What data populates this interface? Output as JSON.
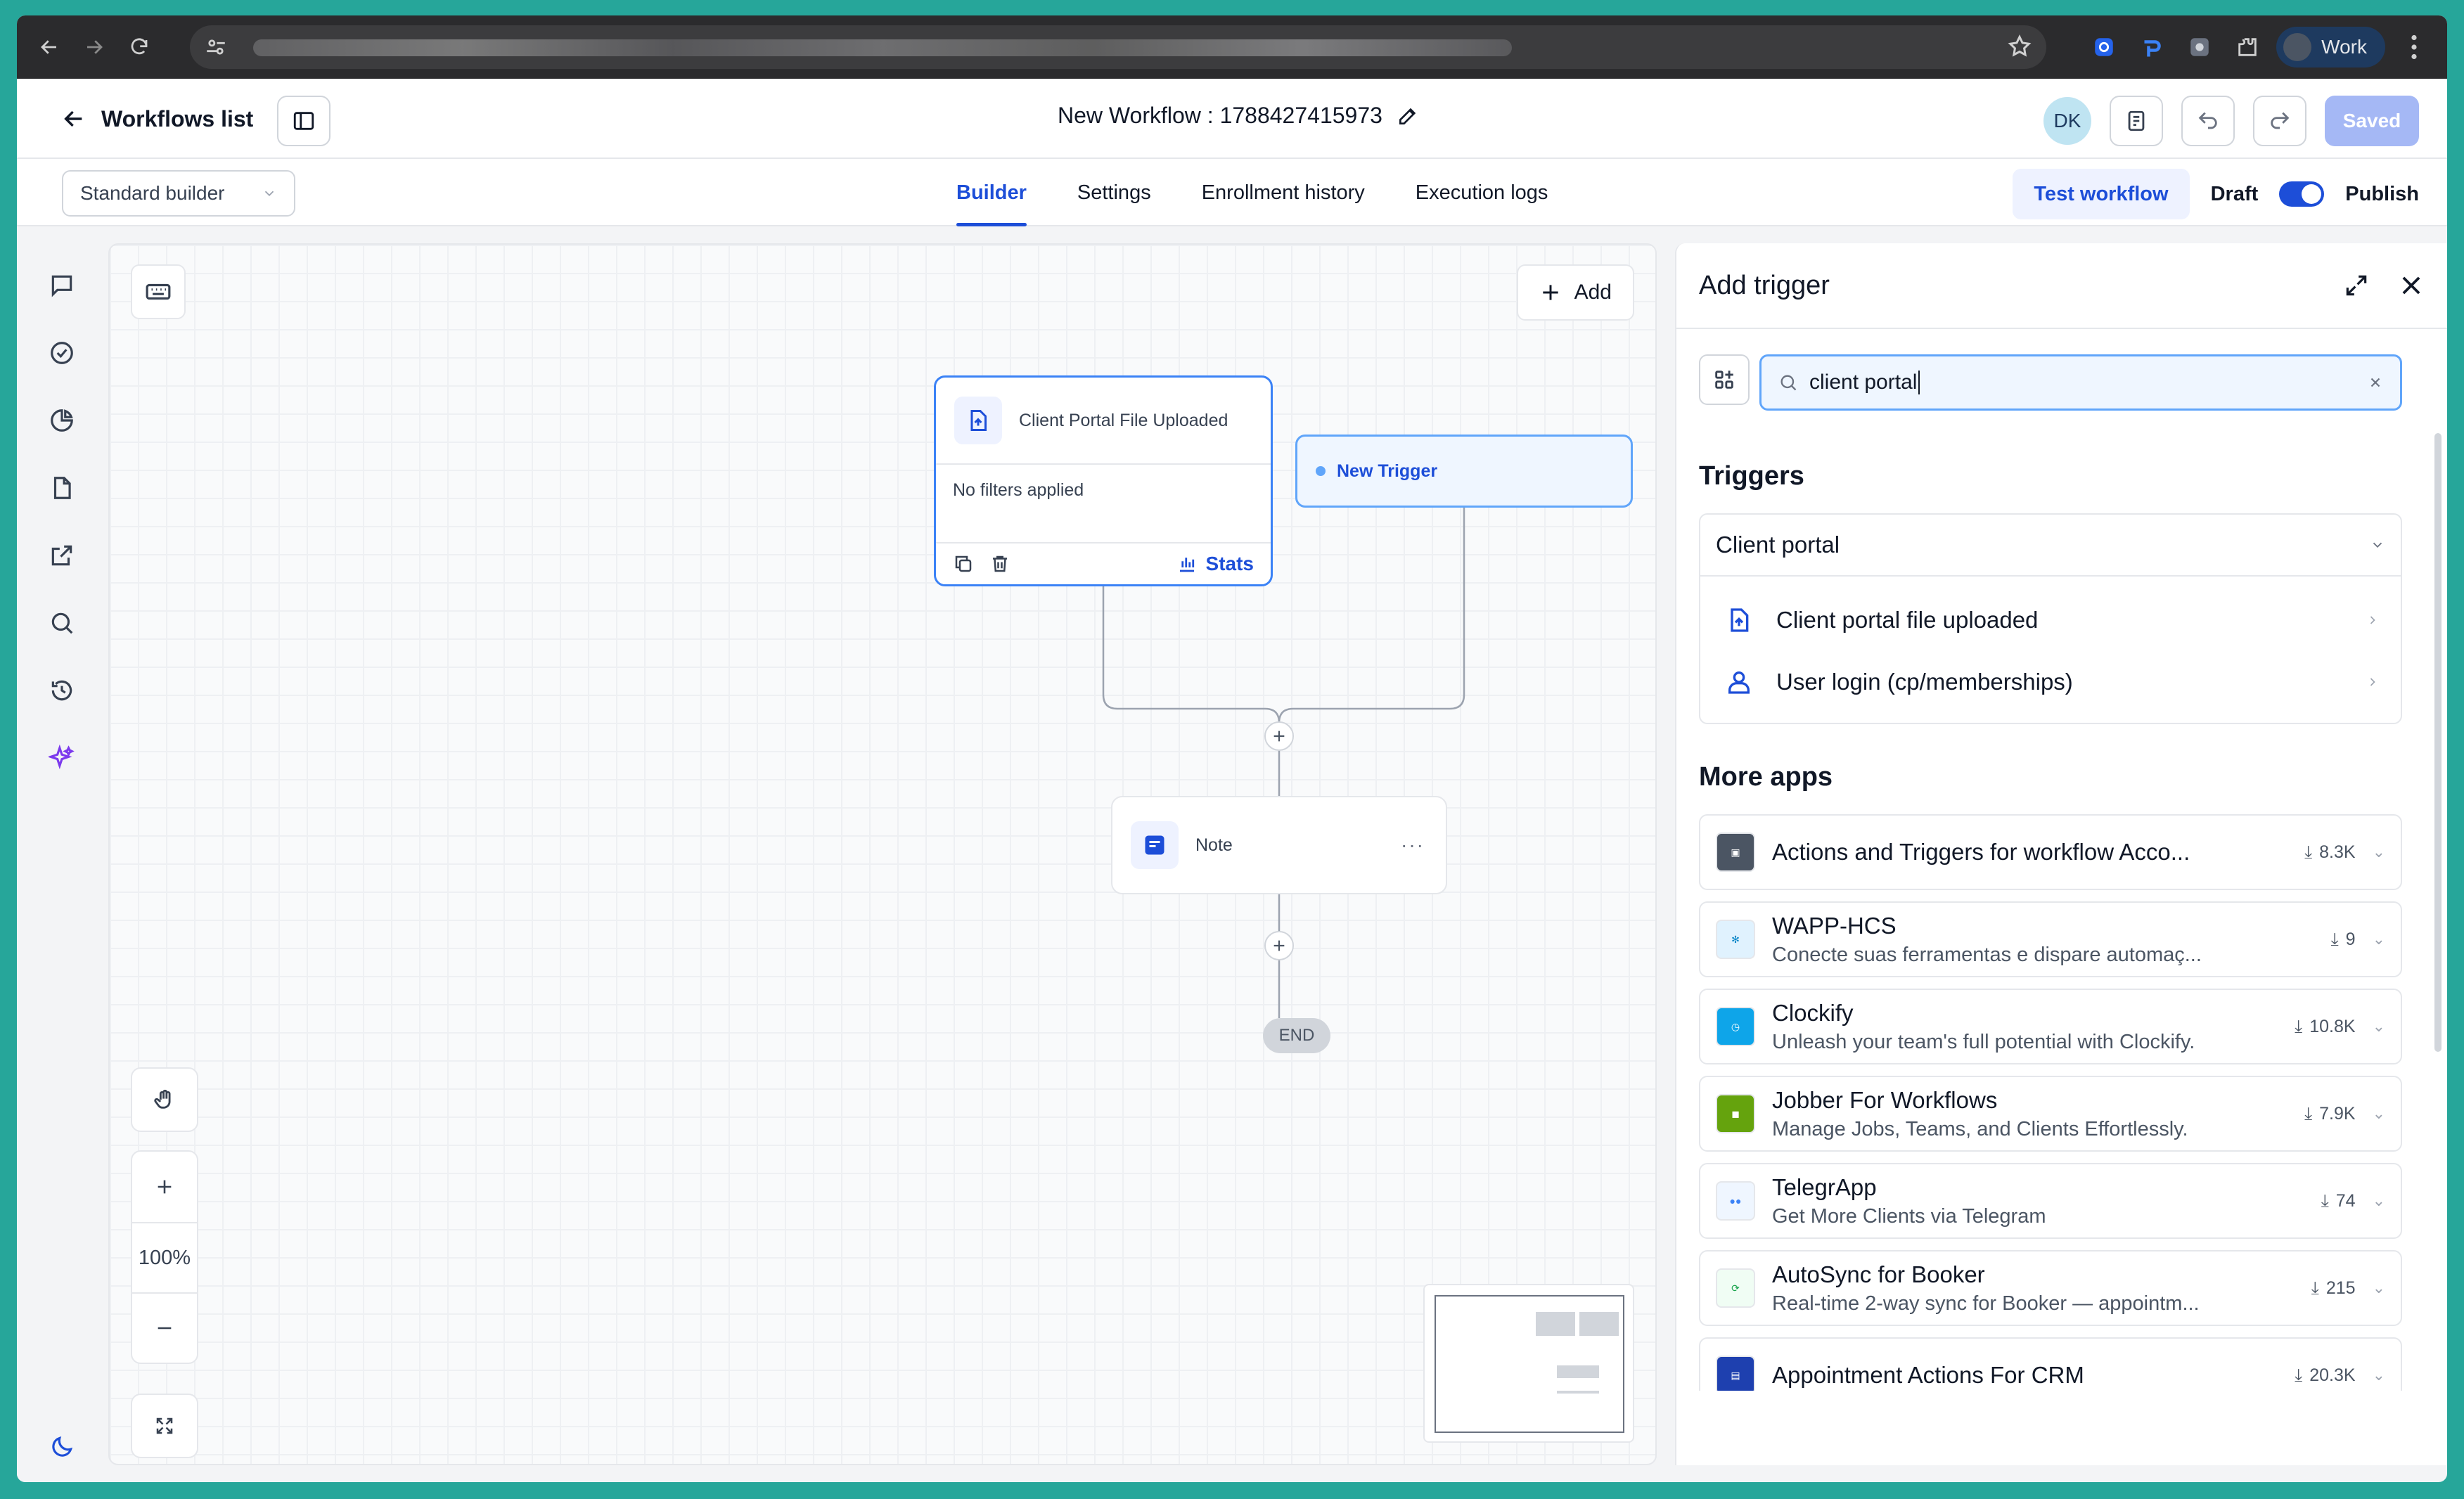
{
  "browser": {
    "profile_label": "Work"
  },
  "header": {
    "back_label": "Workflows list",
    "workflow_title": "New Workflow : 1788427415973",
    "avatar_initials": "DK",
    "saved_label": "Saved"
  },
  "toolbar": {
    "builder_select": "Standard builder",
    "tabs": [
      {
        "label": "Builder",
        "active": true
      },
      {
        "label": "Settings",
        "active": false
      },
      {
        "label": "Enrollment history",
        "active": false
      },
      {
        "label": "Execution logs",
        "active": false
      }
    ],
    "test_label": "Test workflow",
    "draft_label": "Draft",
    "publish_label": "Publish",
    "publish_toggle_on": true
  },
  "canvas": {
    "add_label": "Add",
    "trigger_node": {
      "title": "Client Portal File Uploaded",
      "filters_text": "No filters applied",
      "stats_label": "Stats"
    },
    "new_trigger_label": "New Trigger",
    "note_label": "Note",
    "end_label": "END",
    "zoom_level": "100%"
  },
  "panel": {
    "title": "Add trigger",
    "search_value": "client portal",
    "triggers_heading": "Triggers",
    "group_name": "Client portal",
    "trigger_items": [
      {
        "label": "Client portal file uploaded",
        "icon": "file-upload-icon"
      },
      {
        "label": "User login (cp/memberships)",
        "icon": "user-icon"
      }
    ],
    "more_apps_heading": "More apps",
    "apps": [
      {
        "name": "Actions and Triggers for workflow Acco...",
        "desc": "",
        "installs": "8.3K",
        "logo_color": "#4b5563"
      },
      {
        "name": "WAPP-HCS",
        "desc": "Conecte suas ferramentas e dispare automaç...",
        "installs": "9",
        "logo_color": "#e0f2fe"
      },
      {
        "name": "Clockify",
        "desc": "Unleash your team's full potential with Clockify.",
        "installs": "10.8K",
        "logo_color": "#0ea5e9"
      },
      {
        "name": "Jobber For Workflows",
        "desc": "Manage Jobs, Teams, and Clients Effortlessly.",
        "installs": "7.9K",
        "logo_color": "#65a30d"
      },
      {
        "name": "TelegrApp",
        "desc": "Get More Clients via Telegram",
        "installs": "74",
        "logo_color": "#93c5fd"
      },
      {
        "name": "AutoSync for Booker",
        "desc": "Real-time 2-way sync for Booker — appointm...",
        "installs": "215",
        "logo_color": "#f0fdf4"
      },
      {
        "name": "Appointment Actions For CRM",
        "desc": "",
        "installs": "20.3K",
        "logo_color": "#1e40af"
      }
    ]
  }
}
